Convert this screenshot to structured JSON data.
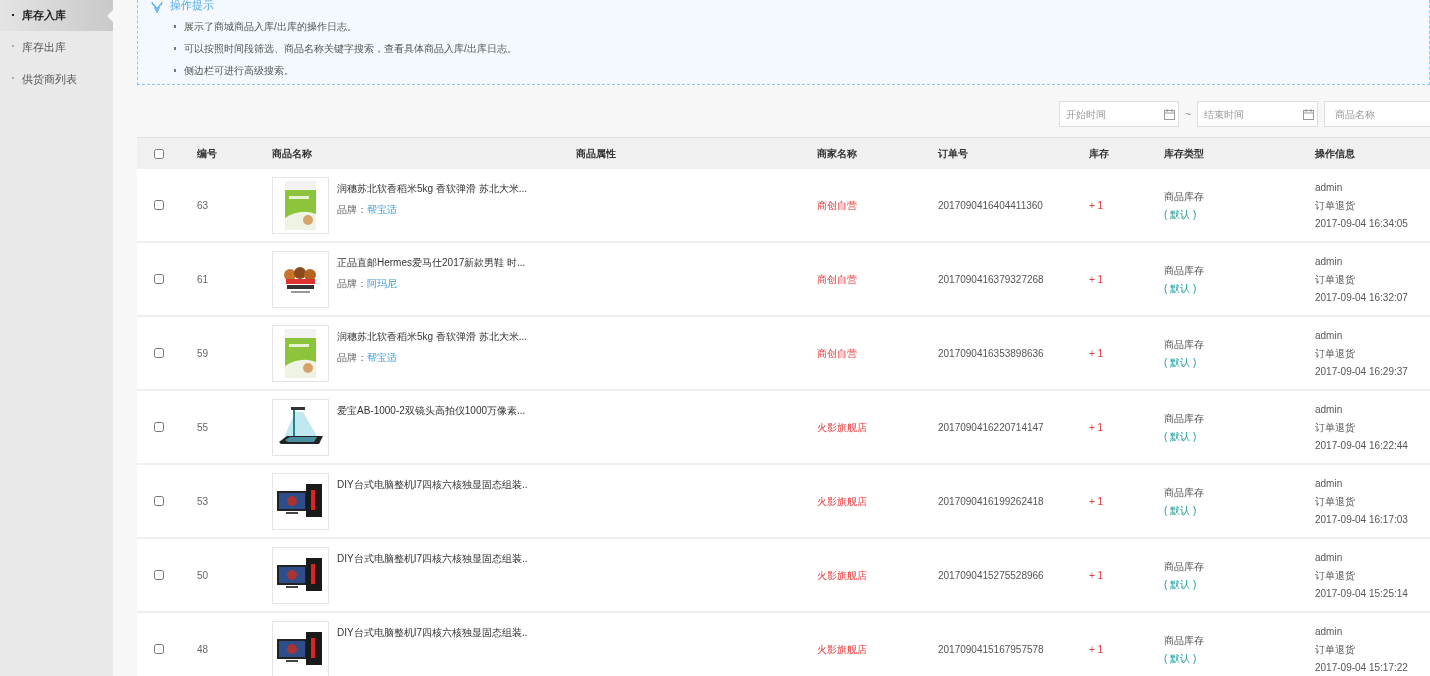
{
  "sidebar": {
    "items": [
      {
        "label": "库存入库",
        "selected": true
      },
      {
        "label": "库存出库",
        "selected": false
      },
      {
        "label": "供货商列表",
        "selected": false
      }
    ]
  },
  "tips": {
    "title": "操作提示",
    "items": [
      "展示了商城商品入库/出库的操作日志。",
      "可以按照时间段筛选、商品名称关键字搜索，查看具体商品入库/出库日志。",
      "侧边栏可进行高级搜索。"
    ]
  },
  "filters": {
    "start_date": {
      "placeholder": "开始时间"
    },
    "separator": "~",
    "end_date": {
      "placeholder": "结束时间"
    },
    "product_name": {
      "placeholder": "商品名称"
    }
  },
  "table": {
    "select_all": {
      "checked": false
    },
    "columns": [
      "编号",
      "商品名称",
      "商品属性",
      "商家名称",
      "订单号",
      "库存",
      "库存类型",
      "操作信息"
    ],
    "rows": [
      {
        "checked": false,
        "id": "63",
        "name": "润穗苏北软香稻米5kg 香软弹滑 苏北大米...",
        "brand_label": "品牌：",
        "brand": "帮宝适",
        "merchant": "商创自营",
        "order": "2017090416404411360",
        "stock": "+ 1",
        "stock_type": "商品库存",
        "stock_default": "( 默认 )",
        "user": "admin",
        "action": "订单退货",
        "time": "2017-09-04 16:34:05"
      },
      {
        "checked": false,
        "id": "61",
        "name": "正品直邮Hermes爱马仕2017新款男鞋 时...",
        "brand_label": "品牌：",
        "brand": "阿玛尼",
        "merchant": "商创自营",
        "order": "2017090416379327268",
        "stock": "+ 1",
        "stock_type": "商品库存",
        "stock_default": "( 默认 )",
        "user": "admin",
        "action": "订单退货",
        "time": "2017-09-04 16:32:07"
      },
      {
        "checked": false,
        "id": "59",
        "name": "润穗苏北软香稻米5kg 香软弹滑 苏北大米...",
        "brand_label": "品牌：",
        "brand": "帮宝适",
        "merchant": "商创自营",
        "order": "2017090416353898636",
        "stock": "+ 1",
        "stock_type": "商品库存",
        "stock_default": "( 默认 )",
        "user": "admin",
        "action": "订单退货",
        "time": "2017-09-04 16:29:37"
      },
      {
        "checked": false,
        "id": "55",
        "name": "爱宝AB-1000-2双镜头高拍仪1000万像素...",
        "merchant": "火影旗舰店",
        "order": "2017090416220714147",
        "stock": "+ 1",
        "stock_type": "商品库存",
        "stock_default": "( 默认 )",
        "user": "admin",
        "action": "订单退货",
        "time": "2017-09-04 16:22:44"
      },
      {
        "checked": false,
        "id": "53",
        "name": "DIY台式电脑整机I7四核六核独显固态组装..",
        "merchant": "火影旗舰店",
        "order": "2017090416199262418",
        "stock": "+ 1",
        "stock_type": "商品库存",
        "stock_default": "( 默认 )",
        "user": "admin",
        "action": "订单退货",
        "time": "2017-09-04 16:17:03"
      },
      {
        "checked": false,
        "id": "50",
        "name": "DIY台式电脑整机I7四核六核独显固态组装..",
        "merchant": "火影旗舰店",
        "order": "2017090415275528966",
        "stock": "+ 1",
        "stock_type": "商品库存",
        "stock_default": "( 默认 )",
        "user": "admin",
        "action": "订单退货",
        "time": "2017-09-04 15:25:14"
      },
      {
        "checked": false,
        "id": "48",
        "name": "DIY台式电脑整机I7四核六核独显固态组装..",
        "merchant": "火影旗舰店",
        "order": "2017090415167957578",
        "stock": "+ 1",
        "stock_type": "商品库存",
        "stock_default": "( 默认 )",
        "user": "admin",
        "action": "订单退货",
        "time": "2017-09-04 15:17:22"
      }
    ]
  }
}
